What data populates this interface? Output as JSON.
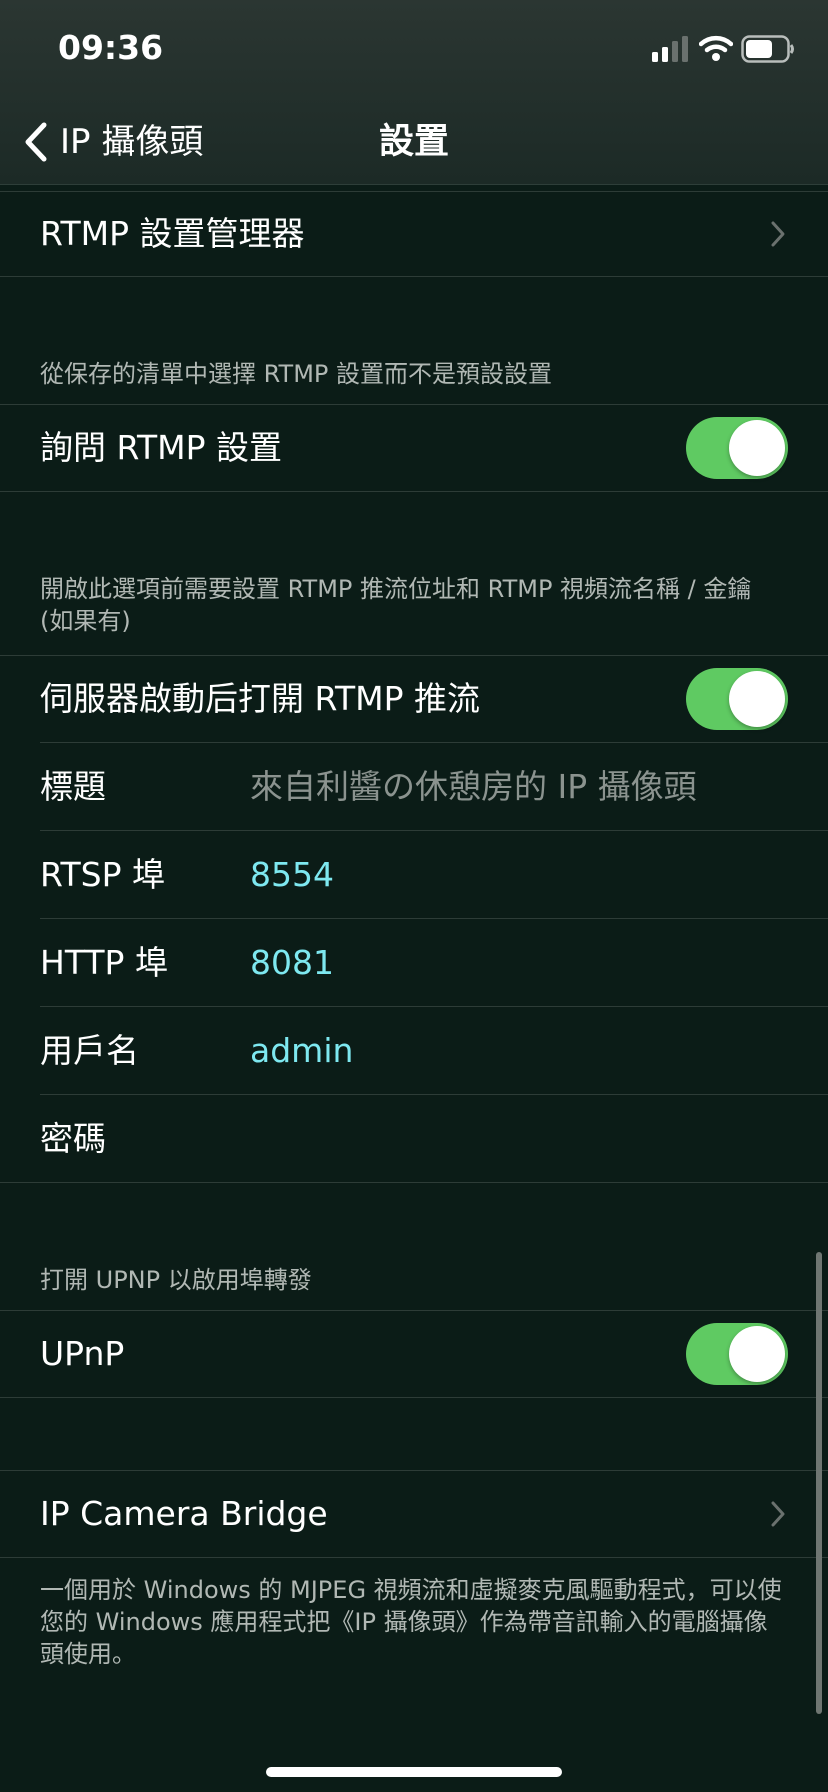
{
  "status_bar": {
    "time": "09:36"
  },
  "nav": {
    "back_label": "IP 攝像頭",
    "title": "設置"
  },
  "rtmp_manager": {
    "label": "RTMP 設置管理器"
  },
  "ask_rtmp": {
    "header": "從保存的清單中選擇 RTMP 設置而不是預設設置",
    "label": "詢問 RTMP 設置",
    "enabled": true
  },
  "rtmp_autostart": {
    "header": "開啟此選項前需要設置 RTMP 推流位址和 RTMP 視頻流名稱 / 金鑰 (如果有)",
    "label": "伺服器啟動后打開 RTMP 推流",
    "enabled": true
  },
  "fields": {
    "title_label": "標題",
    "title_placeholder": "來自利醬の休憩房的 IP 攝像頭",
    "rtsp_label": "RTSP 埠",
    "rtsp_value": "8554",
    "http_label": "HTTP 埠",
    "http_value": "8081",
    "username_label": "用戶名",
    "username_value": "admin",
    "password_label": "密碼"
  },
  "upnp": {
    "header": "打開 UPNP 以啟用埠轉發",
    "label": "UPnP",
    "enabled": true
  },
  "bridge": {
    "label": "IP Camera Bridge",
    "footer": "一個用於 Windows 的 MJPEG 視頻流和虛擬麥克風驅動程式，可以使您的 Windows 應用程式把《IP 攝像頭》作為帶音訊輸入的電腦攝像頭使用。"
  },
  "colors": {
    "background": "#0b1c17",
    "toggle_on": "#5fca62",
    "value_text": "#7ee8f0",
    "placeholder_text": "#8b938f"
  },
  "icons": [
    "chevron-left-icon",
    "cellular-signal-icon",
    "wifi-icon",
    "battery-icon",
    "chevron-right-icon"
  ]
}
